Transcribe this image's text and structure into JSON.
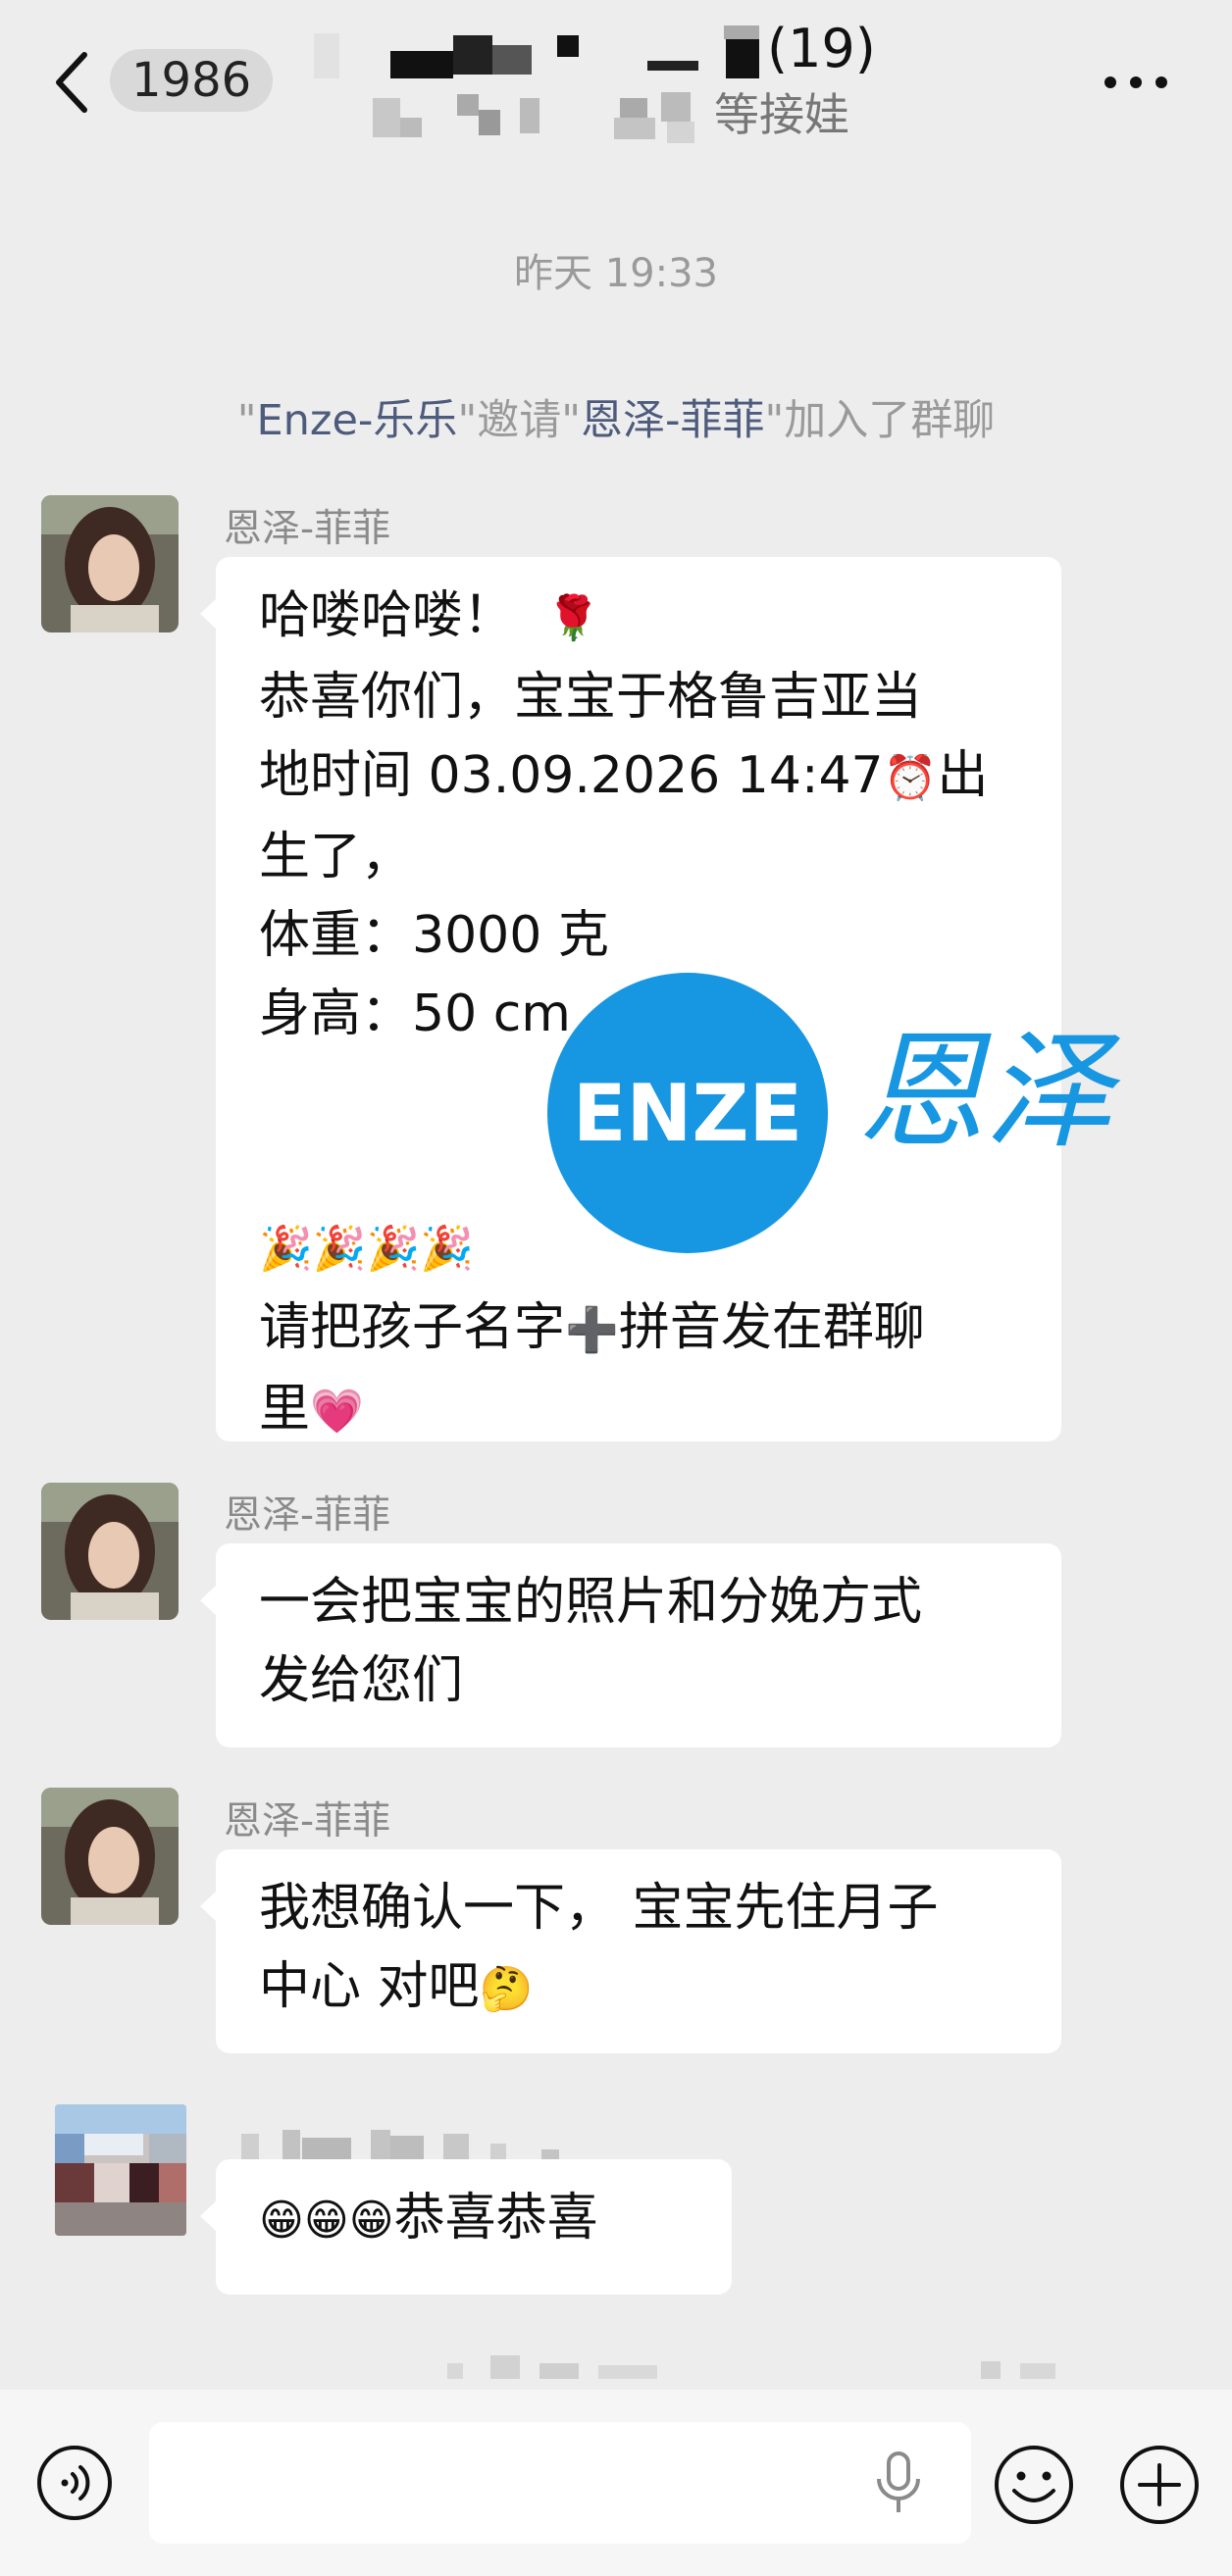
{
  "header": {
    "unread_count": "1986",
    "title_count": "(19)",
    "title_suffix": "等接娃"
  },
  "system": {
    "time": "昨天 19:33",
    "invite": {
      "q1": "\"",
      "inviter": "Enze-乐乐",
      "q2": "\"邀请\"",
      "invitee": "恩泽-菲菲",
      "q3": "\"加入了群聊"
    }
  },
  "messages": [
    {
      "sender": "恩泽-菲菲",
      "lines": [
        "哈喽哈喽！",
        "恭喜你们，宝宝于格鲁吉亚当",
        "地时间 03.09.2026 14:47",
        "生了，",
        "体重：3000 克",
        "身高：50 cm",
        "请把孩子名字",
        "拼音发在群聊",
        "里"
      ],
      "emoji": {
        "rose": "🌹",
        "clock": "⏰",
        "born_suffix": "出",
        "party": "🎉🎉🎉🎉",
        "plus": "➕",
        "heart": "💗"
      }
    },
    {
      "sender": "恩泽-菲菲",
      "lines": [
        "一会把宝宝的照片和分娩方式",
        "发给您们"
      ]
    },
    {
      "sender": "恩泽-菲菲",
      "lines": [
        "我想确认一下， 宝宝先住月子",
        "中心 对吧"
      ],
      "emoji": {
        "think": "🤔"
      }
    },
    {
      "sender": "",
      "lines": [
        "恭喜恭喜"
      ],
      "emoji": {
        "grin": "😁😁😁"
      }
    }
  ],
  "watermark": {
    "logo_text": "ENZE",
    "cn_text": "恩泽",
    "color": "#1796e2"
  },
  "icons": [
    "back-icon",
    "more-icon",
    "voice-icon",
    "mic-icon",
    "emoji-icon",
    "plus-icon"
  ]
}
